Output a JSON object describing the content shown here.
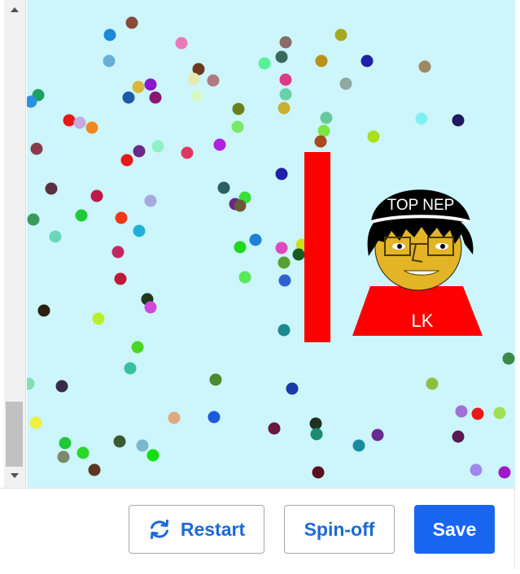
{
  "canvas": {
    "background": "#ccf6fb",
    "bar_color": "#ff0000",
    "character": {
      "hat_text": "TOP NEP",
      "shirt_text": "LK",
      "hat_color": "#000000",
      "face_color": "#e2b426",
      "shirt_color": "#ff0000"
    }
  },
  "toolbar": {
    "restart_label": "Restart",
    "restart_icon": "restart-icon",
    "spinoff_label": "Spin-off",
    "save_label": "Save",
    "accent": "#1865f2"
  }
}
